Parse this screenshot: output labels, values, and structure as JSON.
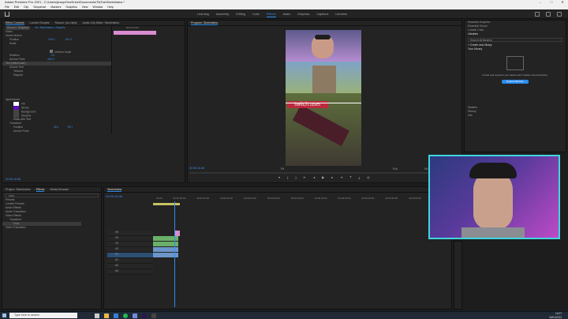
{
  "window": {
    "title": "Adobe Premiere Pro 2021 - C:\\Users\\jessp\\OneDrive\\Documents\\TikTok\\Sketchstew *",
    "controls": [
      "–",
      "□",
      "✕"
    ]
  },
  "menu": [
    "File",
    "Edit",
    "Clip",
    "Sequence",
    "Markers",
    "Graphics",
    "View",
    "Window",
    "Help"
  ],
  "workspaces": [
    "Learning",
    "Assembly",
    "Editing",
    "Color",
    "Effects",
    "Audio",
    "Graphics",
    "Captions",
    "Libraries"
  ],
  "active_workspace": "Effects",
  "effect_controls": {
    "tabs": [
      "Effect Controls",
      "Lumetri Scopes",
      "Source: (no clips)",
      "Audio Clip Mixer: Sketchstew"
    ],
    "source_label": "Source • Graphics",
    "seq_label": "Sk. Sketchstew • Graphic",
    "section_video": "Video",
    "props": [
      "Vector Motion",
      "Position",
      "Scale",
      "",
      "Uniform Scale",
      "Rotation",
      "Anchor Point"
    ],
    "vals": [
      "100.0",
      "100.0",
      "",
      "",
      "0.0",
      "540.0"
    ],
    "text_layer": "Text (twitch/user)",
    "source_text": "Source Text",
    "font": "Tahoma",
    "font_style": "Regular",
    "appearance": "Appearance",
    "fill": "Fill",
    "stroke": "Stroke",
    "background": "Background",
    "shadow": "Shadow",
    "mask": "Mask with Text",
    "transform": "Transform",
    "position": "Position",
    "pos_x": "26.1",
    "pos_y": "93.7",
    "anchor": "Anchor Point",
    "timecode": "00:00:16:48",
    "time_mini": "00:00:15:00"
  },
  "program": {
    "label": "Program: Sketchstew",
    "overlay_text": "twitch.user",
    "timecode": "00:00:16:48",
    "fit": "Fit",
    "full": "Full",
    "duration": "00:00:35:19"
  },
  "libraries": {
    "items": [
      "Essential Graphics",
      "Essential Sound",
      "Lumetri Color",
      "Libraries"
    ],
    "search_placeholder": "Search all libraries",
    "create": "+ Create new library",
    "your_library": "Your Library",
    "empty_msg": "Create and organize your assets with Creative Cloud Libraries.",
    "explore": "Explore libraries",
    "bottom": [
      "Markers",
      "History",
      "Info"
    ]
  },
  "project": {
    "tabs": [
      "Project: Sketchstew",
      "Effects",
      "Media Browser"
    ],
    "search": "crop",
    "tree": [
      "Presets",
      "Lumetri Presets",
      "Audio Effects",
      "Audio Transitions",
      "Video Effects",
      "Transform",
      "Crop",
      "Video Transitions"
    ]
  },
  "timeline": {
    "title": "Sketchstew",
    "timecode": "00:00:16:48",
    "ruler": [
      "00:00",
      "00:00:05:00",
      "00:00:10:00",
      "00:00:15:00",
      "00:00:20:00",
      "00:00:25:00",
      "00:00:30:00",
      "00:00:35:00",
      "00:00:40:00",
      "00:00:45:00",
      "00:00:50:00",
      "00:00:55:00",
      "00:01:00:00"
    ],
    "tracks": [
      "V5",
      "V4",
      "V3",
      "V2",
      "V1",
      "A1",
      "A2",
      "A3"
    ]
  },
  "taskbar": {
    "search": "Type here to search",
    "time": "14:07",
    "date": "30/01/2022"
  }
}
